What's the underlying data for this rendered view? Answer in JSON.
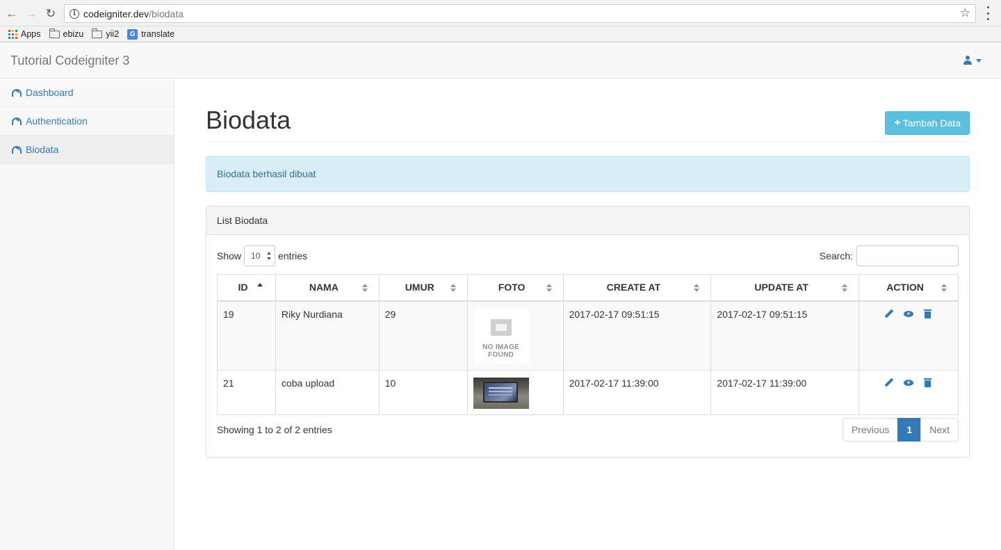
{
  "browser": {
    "url_host": "codeigniter.dev",
    "url_path": "/biodata",
    "bookmarks": [
      {
        "label": "Apps",
        "icon": "apps-grid-icon"
      },
      {
        "label": "ebizu",
        "icon": "folder-icon"
      },
      {
        "label": "yii2",
        "icon": "folder-icon"
      },
      {
        "label": "translate",
        "icon": "google-translate-icon"
      }
    ]
  },
  "navbar": {
    "brand": "Tutorial Codeigniter 3",
    "user_icon": "user-icon"
  },
  "sidebar": {
    "items": [
      {
        "label": "Dashboard",
        "icon": "dashboard-icon",
        "active": false
      },
      {
        "label": "Authentication",
        "icon": "dashboard-icon",
        "active": false
      },
      {
        "label": "Biodata",
        "icon": "dashboard-icon",
        "active": true
      }
    ]
  },
  "page": {
    "title": "Biodata",
    "add_button": "Tambah Data",
    "alert": "Biodata berhasil dibuat"
  },
  "panel": {
    "title": "List Biodata",
    "show_label": "Show",
    "length_value": "10",
    "entries_label": "entries",
    "search_label": "Search:",
    "search_value": "",
    "columns": [
      "ID",
      "NAMA",
      "UMUR",
      "FOTO",
      "CREATE AT",
      "UPDATE AT",
      "ACTION"
    ],
    "sorted_column": "ID",
    "rows": [
      {
        "id": "19",
        "nama": "Riky Nurdiana",
        "umur": "29",
        "foto": "no-image",
        "foto_text_1": "NO IMAGE",
        "foto_text_2": "FOUND",
        "create_at": "2017-02-17 09:51:15",
        "update_at": "2017-02-17 09:51:15"
      },
      {
        "id": "21",
        "nama": "coba upload",
        "umur": "10",
        "foto": "photo",
        "create_at": "2017-02-17 11:39:00",
        "update_at": "2017-02-17 11:39:00"
      }
    ],
    "info": "Showing 1 to 2 of 2 entries",
    "pagination": {
      "previous": "Previous",
      "current": "1",
      "next": "Next"
    }
  },
  "colors": {
    "primary": "#337ab7",
    "info_button": "#5bc0de",
    "alert_bg": "#d9edf7",
    "alert_text": "#31708f"
  }
}
